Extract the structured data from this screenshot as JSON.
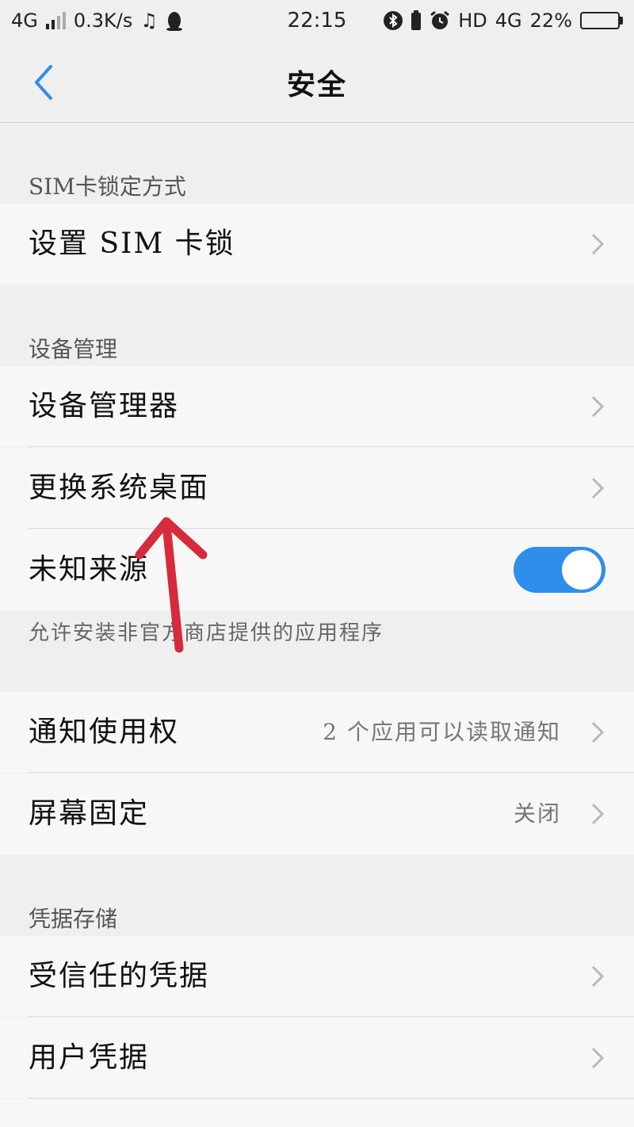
{
  "status_bar": {
    "network": "4G",
    "speed": "0.3K/s",
    "time": "22:15",
    "hd": "HD",
    "network_right": "4G",
    "battery_percent": "22%",
    "battery_level": 0.22
  },
  "header": {
    "title": "安全"
  },
  "sections": {
    "sim": {
      "header": "SIM卡锁定方式",
      "items": [
        {
          "label": "设置 SIM 卡锁"
        }
      ]
    },
    "device": {
      "header": "设备管理",
      "items": [
        {
          "label": "设备管理器"
        },
        {
          "label": "更换系统桌面"
        },
        {
          "label": "未知来源",
          "toggle_on": true,
          "description": "允许安装非官方商店提供的应用程序"
        }
      ]
    },
    "misc": {
      "items": [
        {
          "label": "通知使用权",
          "value": "2 个应用可以读取通知"
        },
        {
          "label": "屏幕固定",
          "value": "关闭"
        }
      ]
    },
    "credentials": {
      "header": "凭据存储",
      "items": [
        {
          "label": "受信任的凭据"
        },
        {
          "label": "用户凭据"
        }
      ]
    }
  },
  "colors": {
    "accent": "#2f8ee9",
    "annotation_arrow": "#d62b3c",
    "background": "#efefef",
    "row_background": "#f7f7f7"
  }
}
